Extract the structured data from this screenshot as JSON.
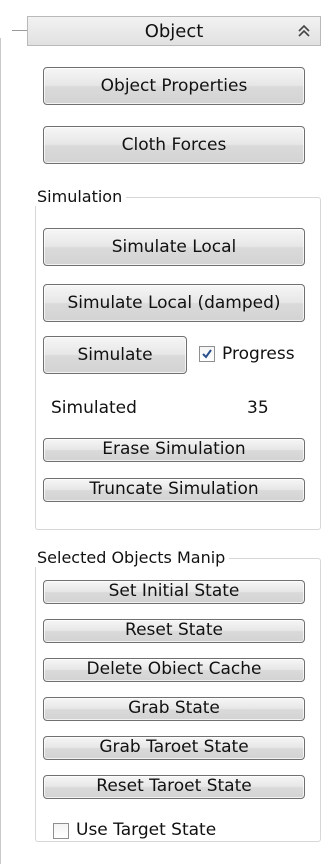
{
  "rollout": {
    "title": "Object",
    "collapse_icon": "double-chevron-up-icon"
  },
  "top_buttons": {
    "object_properties": "Object Properties",
    "cloth_forces": "Cloth Forces"
  },
  "simulation": {
    "group_label": "Simulation",
    "simulate_local": "Simulate Local",
    "simulate_local_damped": "Simulate Local (damped)",
    "simulate": "Simulate",
    "progress_label": "Progress",
    "progress_checked": true,
    "simulated_label": "Simulated",
    "simulated_value": "35",
    "erase_simulation": "Erase Simulation",
    "truncate_simulation": "Truncate Simulation"
  },
  "selected_objects": {
    "group_label": "Selected Objects Manip",
    "set_initial_state": "Set Initial State",
    "reset_state": "Reset State",
    "delete_object_cache": "Delete Obiect Cache",
    "grab_state": "Grab State",
    "grab_target_state": "Grab Taroet State",
    "reset_target_state": "Reset Taroet State",
    "use_target_state_label": "Use Target State",
    "use_target_state_checked": false
  },
  "colors": {
    "check_mark": "#2a4f8f",
    "button_border": "#707070",
    "group_border": "#d7d7d7"
  }
}
